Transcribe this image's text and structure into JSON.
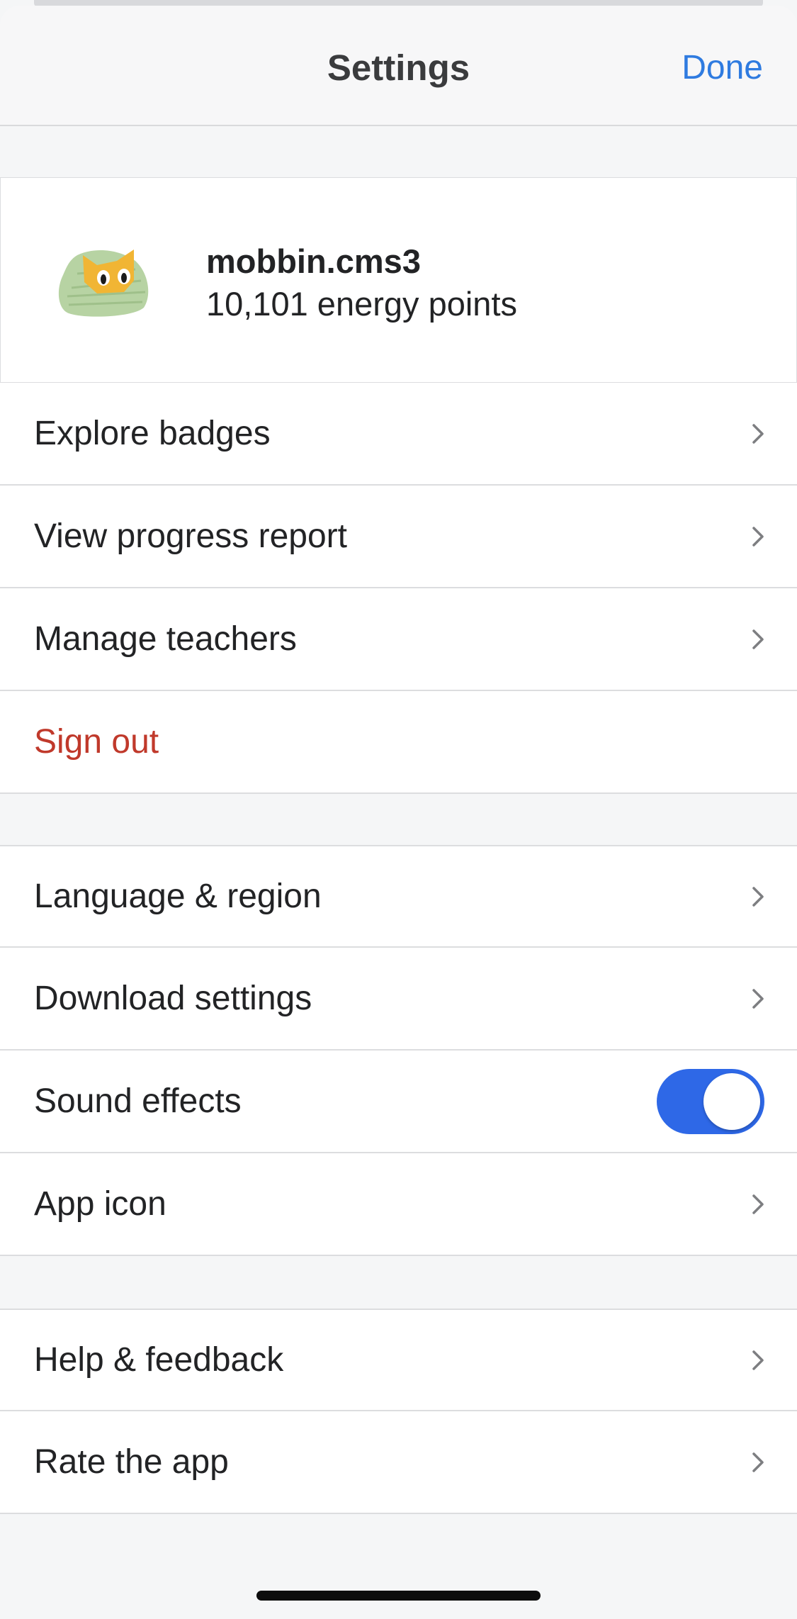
{
  "header": {
    "title": "Settings",
    "done_label": "Done"
  },
  "profile": {
    "username": "mobbin.cms3",
    "points": "10,101 energy points"
  },
  "account_items": [
    {
      "label": "Explore badges"
    },
    {
      "label": "View progress report"
    },
    {
      "label": "Manage teachers"
    },
    {
      "label": "Sign out"
    }
  ],
  "preference_items": [
    {
      "label": "Language & region"
    },
    {
      "label": "Download settings"
    },
    {
      "label": "Sound effects",
      "toggle_on": true
    },
    {
      "label": "App icon"
    }
  ],
  "support_items": [
    {
      "label": "Help & feedback"
    },
    {
      "label": "Rate the app"
    }
  ],
  "colors": {
    "accent": "#2f7be0",
    "toggle_on": "#2e68e7",
    "danger": "#c0392b",
    "background": "#f5f6f7"
  },
  "icons": {
    "chevron": "chevron-right-icon",
    "avatar": "owl-avatar-icon"
  }
}
